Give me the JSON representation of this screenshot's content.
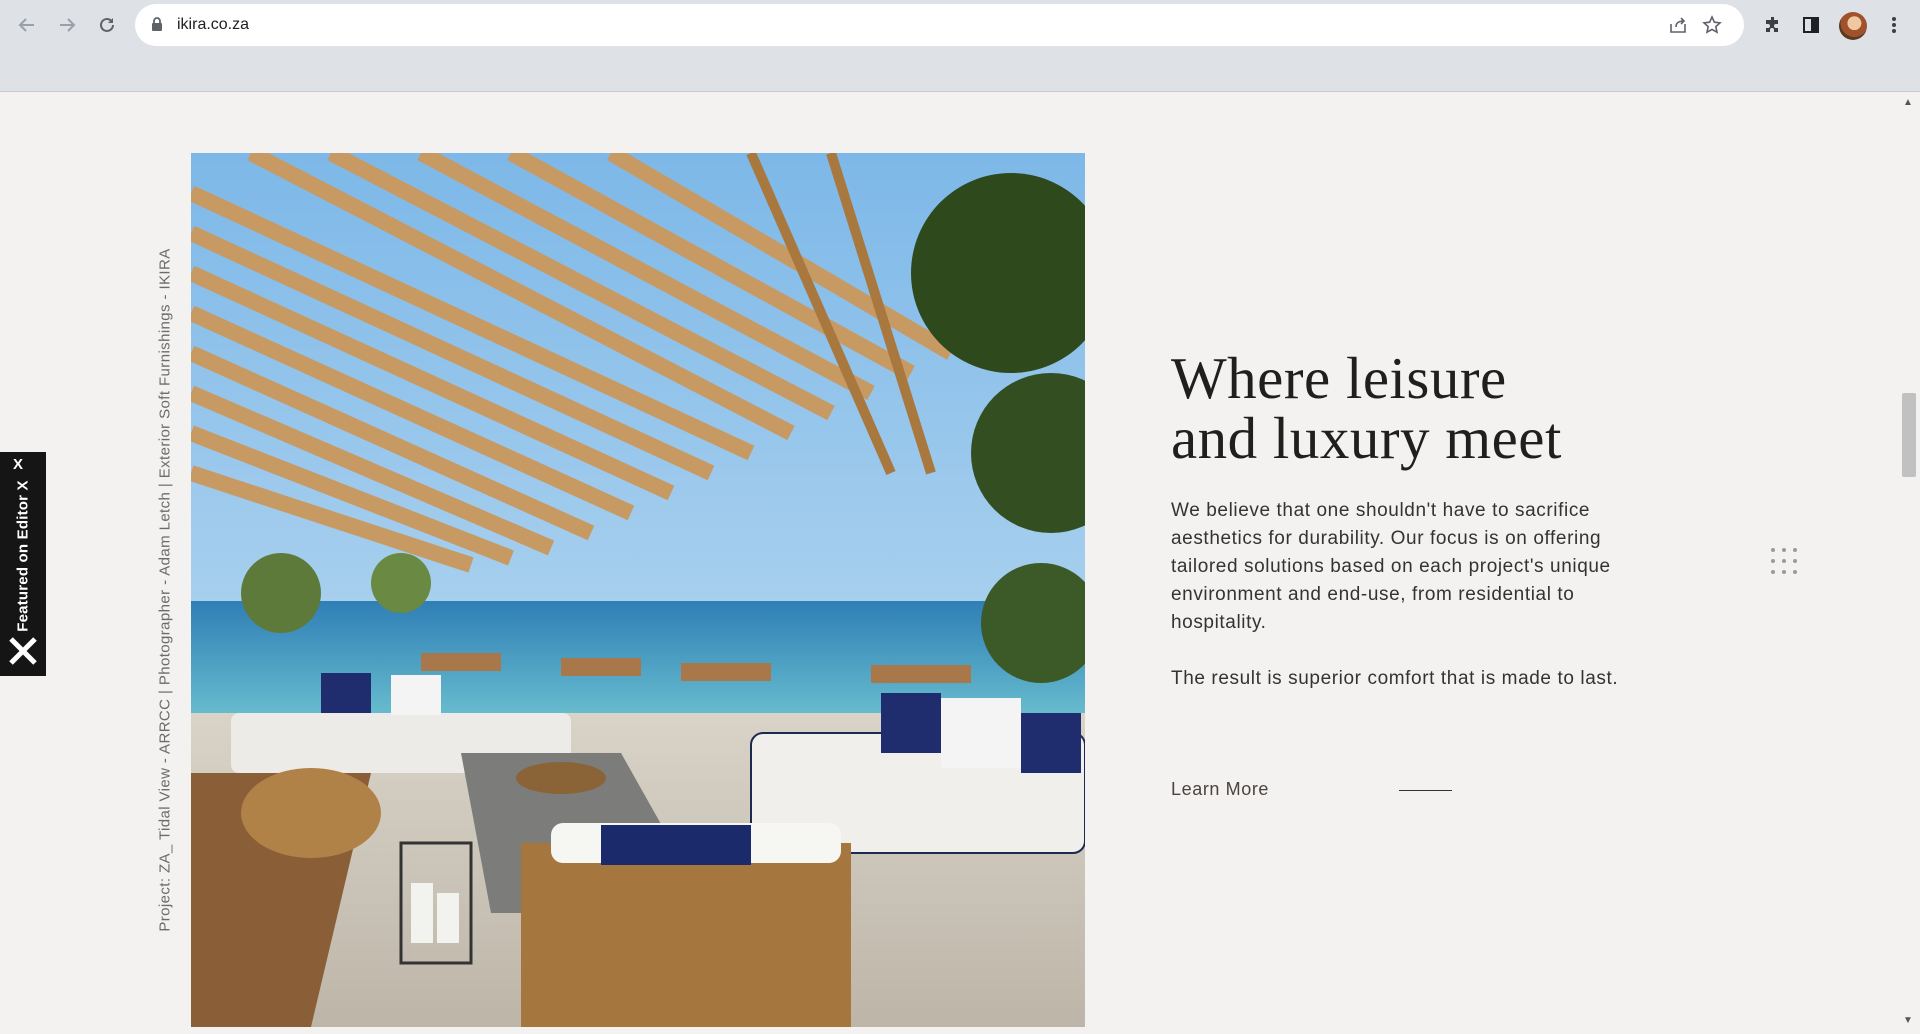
{
  "browser": {
    "url": "ikira.co.za",
    "icons": [
      "back-icon",
      "forward-icon",
      "reload-icon",
      "lock-icon",
      "share-icon",
      "star-icon",
      "extensions-icon",
      "side-panel-icon",
      "avatar",
      "menu-icon"
    ]
  },
  "editor_badge": {
    "label": "Featured on Editor X",
    "close": "X"
  },
  "credits": "Project:  ZA_ Tidal View - ARRCC  |  Photographer - Adam Letch  |  Exterior Soft Furnishings - IKIRA",
  "hero": {
    "heading_line1": "Where leisure",
    "heading_line2": "and luxury meet",
    "paragraph1": "We believe that one shouldn't have to sacrifice aesthetics for durability. Our focus is on offering tailored solutions based on each project's unique environment and end-use, from residential to hospitality.",
    "paragraph2": "The result is superior comfort that is made to last.",
    "cta_label": "Learn More"
  },
  "colors": {
    "page_bg": "#f4f2f0",
    "chrome_bg": "#dee1e6",
    "heading": "#1f1f1f",
    "badge_bg": "#151515"
  }
}
